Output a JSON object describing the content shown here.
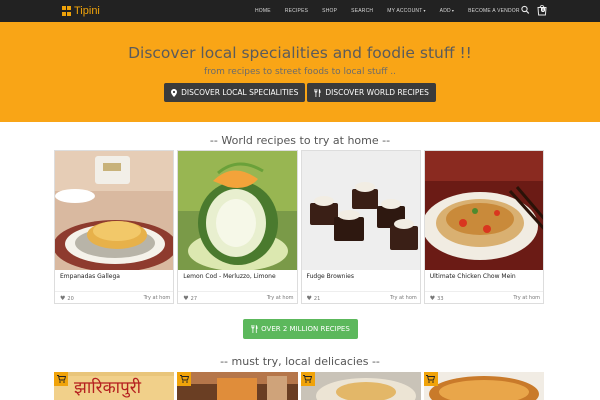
{
  "navbar": {
    "brand": "Tipini",
    "links": [
      "HOME",
      "RECIPES",
      "SHOP",
      "SEARCH",
      "MY ACCOUNT",
      "ADD",
      "BECOME A VENDOR"
    ],
    "cart_count": "0",
    "colors": {
      "background": "#222222",
      "brand": "#f0a30a"
    }
  },
  "hero": {
    "title": "Discover local specialities and foodie stuff !!",
    "subtitle": "from recipes to street foods to local stuff ..",
    "btn_local": "DISCOVER LOCAL SPECIALITIES",
    "btn_world": "DISCOVER WORLD RECIPES",
    "background": "#f9a516"
  },
  "world_section": {
    "heading": "-- World recipes to try at home --",
    "cards": [
      {
        "title": "Empanadas Gallega",
        "likes": "20",
        "cta": "Try at hom"
      },
      {
        "title": "Lemon Cod - Merluzzo, Limone",
        "likes": "27",
        "cta": "Try at hom"
      },
      {
        "title": "Fudge Brownies",
        "likes": "21",
        "cta": "Try at hom"
      },
      {
        "title": "Ultimate Chicken Chow Mein",
        "likes": "33",
        "cta": "Try at hom"
      }
    ]
  },
  "cta_button": {
    "label": "OVER 2 MILLION RECIPES",
    "color": "#5cb85c"
  },
  "local_section": {
    "heading": "-- must try, local delicacies --",
    "tag_color": "#f0a30a"
  }
}
